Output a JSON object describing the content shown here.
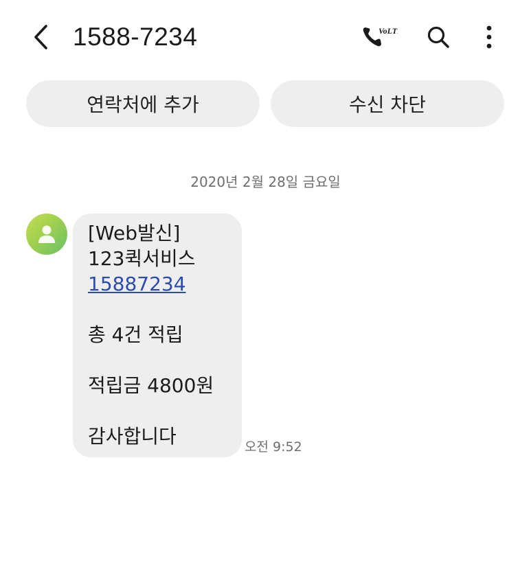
{
  "header": {
    "title": "1588-7234",
    "back_icon": "chevron-left-icon",
    "call_icon": "volte-call-icon",
    "call_badge": "VoLTE",
    "search_icon": "search-icon",
    "more_icon": "more-vertical-icon"
  },
  "actions": {
    "add_contact_label": "연락처에 추가",
    "block_label": "수신 차단"
  },
  "conversation": {
    "date_separator": "2020년 2월 28일 금요일",
    "messages": [
      {
        "sender_avatar_icon": "person-icon",
        "avatar_color": "#9fd04e",
        "lines": {
          "line1": "[Web발신]",
          "line2": "123퀵서비스",
          "link": "15887234",
          "line4": "총 4건 적립",
          "line5": "적립금 4800원",
          "line6": "감사합니다"
        },
        "time": "오전 9:52"
      }
    ]
  },
  "colors": {
    "bubble_bg": "#eeeeee",
    "pill_bg": "#eeeeee",
    "link": "#2a4cb0",
    "secondary_text": "#6e6e6e"
  }
}
